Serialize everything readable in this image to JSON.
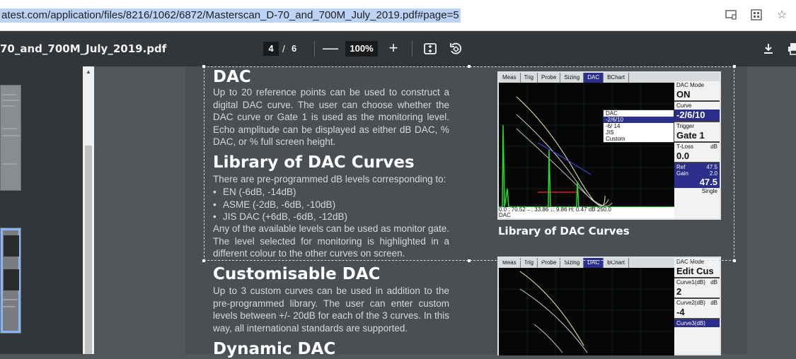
{
  "browser": {
    "url": "atest.com/application/files/8216/1062/6872/Masterscan_D-70_and_700M_July_2019.pdf#page=5",
    "icons": [
      "cast-icon",
      "extension-icon",
      "bookmark-star-icon"
    ]
  },
  "viewer": {
    "title": "70_and_700M_July_2019.pdf",
    "page_current": "4",
    "page_sep": "/",
    "page_total": "6",
    "zoom": "100%",
    "minus": "—",
    "plus": "+"
  },
  "content": {
    "dac_heading": "DAC",
    "dac_text": "Up to 20 reference points can be used to construct a digital DAC curve. The user can choose whether the DAC curve or Gate 1 is used as the monitoring level. Echo amplitude can be displayed as either dB DAC, % DAC, or % full screen height.",
    "library_heading": "Library of DAC Curves",
    "library_intro": "There are pre-programmed dB levels corresponding to:",
    "library_items": [
      "EN (-6dB, -14dB)",
      "ASME (-2dB, -6dB, -10dB)",
      "JIS DAC (+6dB, -6dB, -12dB)"
    ],
    "library_text": "Any of the available levels can be used as monitor gate. The level selected for monitoring is highlighted in a different colour to the other curves on screen.",
    "custom_heading": "Customisable DAC",
    "custom_text": "Up to 3 custom curves can be used in addition to the pre-programmed library. The user can enter custom levels between +/- 20dB for each of the 3 curves. In this way, all international standards are supported.",
    "dynamic_heading": "Dynamic DAC",
    "caption": "Library of DAC Curves"
  },
  "screen1": {
    "tabs": [
      "Meas",
      "Trig",
      "Probe",
      "Sizing",
      "DAC",
      "BChart"
    ],
    "active_tab": "DAC",
    "popup": [
      "DAC",
      "-2/6/10",
      "-6/ 14",
      "JIS",
      "Custom"
    ],
    "popup_highlight": "-2/6/10",
    "right": [
      {
        "label": "DAC Mode",
        "value": "ON",
        "sel": false
      },
      {
        "label": "Curve",
        "value": "-2/6/10",
        "sel": true
      },
      {
        "label": "Trigger",
        "value": "Gate 1",
        "sel": false
      },
      {
        "label": "T-Loss",
        "unit": "dB",
        "value": "0.0",
        "sel": false
      }
    ],
    "ref_label": "Ref",
    "ref_value": "47.5",
    "gain_label": "Gain",
    "gain_step": "2.0",
    "gain_value": "47.5",
    "mode": "Single",
    "readout_line1": "0.0 :  70.52→:  33.86 ↓:   9.86  H:  0.47  dB  250.0",
    "readout_line2": "DAC"
  },
  "screen2": {
    "tabs": [
      "Meas",
      "Trig",
      "Probe",
      "Sizing",
      "DAC",
      "BChart"
    ],
    "active_tab": "DAC",
    "right": [
      {
        "label": "DAC Mode",
        "value": "Edit Cus",
        "sel": false
      },
      {
        "label": "Curve1(dB)",
        "unit": "dB",
        "value": "2",
        "sel": false
      },
      {
        "label": "Curve2(dB)",
        "unit": "dB",
        "value": "-4",
        "sel": false
      },
      {
        "label": "Curve3(dB)",
        "value": "",
        "sel": true
      }
    ]
  }
}
